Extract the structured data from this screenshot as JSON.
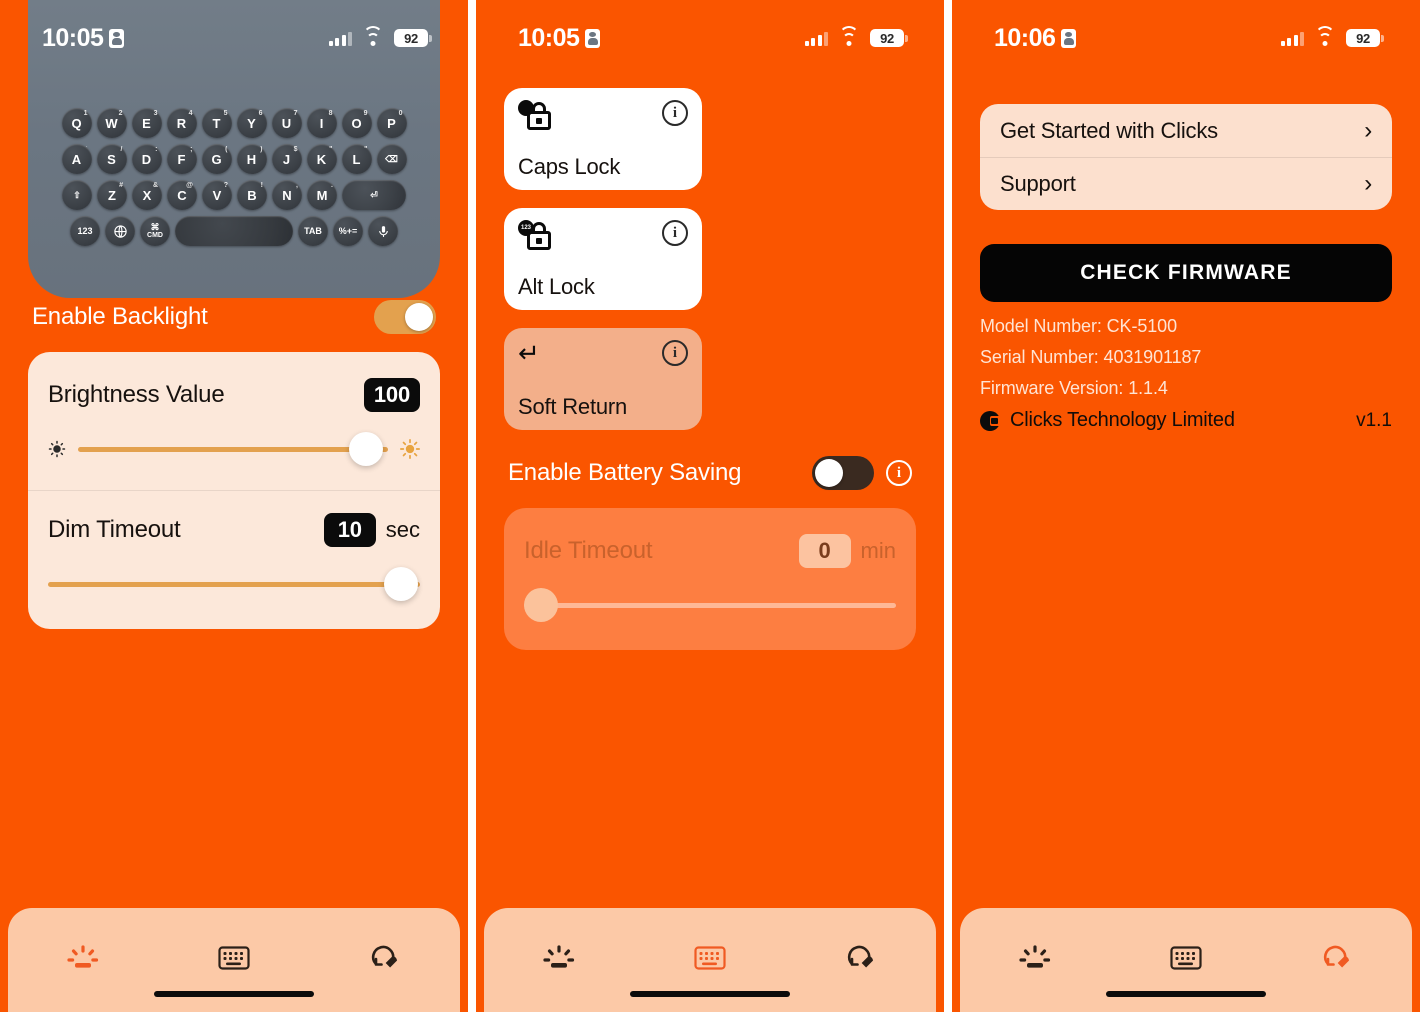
{
  "app": {
    "accent_orange": "#FA5500",
    "cream": "#FCE8DA",
    "amber": "#E3A14E",
    "tabbar_bg": "#FCC9A7"
  },
  "screens": [
    {
      "id": "backlight",
      "status": {
        "time": "10:05",
        "battery": "92",
        "id_icon": "id-card-icon",
        "signal_icon": "cellular-bars-icon",
        "wifi_icon": "wifi-icon"
      },
      "keyboard_hero": {
        "alt": "clicks-keyboard-photo",
        "row1": [
          {
            "key": "Q",
            "sup": "1"
          },
          {
            "key": "W",
            "sup": "2"
          },
          {
            "key": "E",
            "sup": "3"
          },
          {
            "key": "R",
            "sup": "4"
          },
          {
            "key": "T",
            "sup": "5"
          },
          {
            "key": "Y",
            "sup": "6"
          },
          {
            "key": "U",
            "sup": "7"
          },
          {
            "key": "I",
            "sup": "8"
          },
          {
            "key": "O",
            "sup": "9"
          },
          {
            "key": "P",
            "sup": "0"
          }
        ],
        "row2": [
          {
            "key": "A",
            "sup": "`"
          },
          {
            "key": "S",
            "sup": "/"
          },
          {
            "key": "D",
            "sup": ":"
          },
          {
            "key": "F",
            "sup": ";"
          },
          {
            "key": "G",
            "sup": "("
          },
          {
            "key": "H",
            "sup": ")"
          },
          {
            "key": "J",
            "sup": "$"
          },
          {
            "key": "K",
            "sup": "\""
          },
          {
            "key": "L",
            "sup": "\""
          },
          {
            "key": "⌫",
            "sup": ""
          }
        ],
        "row3": [
          {
            "key": "⇧",
            "sup": ""
          },
          {
            "key": "Z",
            "sup": "#"
          },
          {
            "key": "X",
            "sup": "&"
          },
          {
            "key": "C",
            "sup": "@"
          },
          {
            "key": "V",
            "sup": "?"
          },
          {
            "key": "B",
            "sup": "!"
          },
          {
            "key": "N",
            "sup": ","
          },
          {
            "key": "M",
            "sup": "."
          },
          {
            "key": "⏎",
            "sup": ""
          }
        ],
        "row4": [
          {
            "key": "123"
          },
          {
            "key": "globe"
          },
          {
            "key": "⌘",
            "sub": "CMD"
          },
          {
            "key": "space"
          },
          {
            "key": "TAB"
          },
          {
            "key": "%+="
          },
          {
            "key": "mic"
          }
        ]
      },
      "enable_toggle": {
        "label": "Enable Backlight",
        "state": "on"
      },
      "sections": [
        {
          "title": "Brightness Value",
          "value": "100",
          "unit": "",
          "slider": {
            "percent": 93,
            "left_icon": "sun-dim-icon",
            "right_icon": "sun-bright-icon"
          }
        },
        {
          "title": "Dim Timeout",
          "value": "10",
          "unit": "sec",
          "slider": {
            "percent": 95,
            "left_icon": "",
            "right_icon": ""
          }
        }
      ],
      "tabs": [
        {
          "name": "backlight",
          "icon": "backlight-icon",
          "active": true
        },
        {
          "name": "keyboard",
          "icon": "keyboard-icon",
          "active": false
        },
        {
          "name": "support",
          "icon": "support-refresh-icon",
          "active": false
        }
      ]
    },
    {
      "id": "keyboard",
      "status": {
        "time": "10:05",
        "battery": "92",
        "id_icon": "id-card-icon",
        "signal_icon": "cellular-bars-icon",
        "wifi_icon": "wifi-icon"
      },
      "tiles": [
        {
          "label": "Caps Lock",
          "icon": "caps-lock-icon",
          "badge": "",
          "badge_style": "dot",
          "active": false,
          "info": "i"
        },
        {
          "label": "Alt Lock",
          "icon": "alt-lock-icon",
          "badge": "123",
          "badge_style": "text",
          "active": false,
          "info": "i"
        },
        {
          "label": "Soft Return",
          "icon": "soft-return-icon",
          "badge": "",
          "badge_style": "none",
          "active": true,
          "info": "i"
        }
      ],
      "enable_toggle": {
        "label": "Enable Battery Saving",
        "state": "off",
        "info": "i"
      },
      "sections": [
        {
          "title": "Idle Timeout",
          "value": "0",
          "unit": "min",
          "disabled": true,
          "slider": {
            "percent": 0
          }
        }
      ],
      "tabs": [
        {
          "name": "backlight",
          "icon": "backlight-icon",
          "active": false
        },
        {
          "name": "keyboard",
          "icon": "keyboard-icon",
          "active": true
        },
        {
          "name": "support",
          "icon": "support-refresh-icon",
          "active": false
        }
      ]
    },
    {
      "id": "support",
      "status": {
        "time": "10:06",
        "battery": "92",
        "id_icon": "id-card-icon",
        "signal_icon": "cellular-bars-icon",
        "wifi_icon": "wifi-icon"
      },
      "links": [
        {
          "label": "Get Started with Clicks",
          "chevron": "›"
        },
        {
          "label": "Support",
          "chevron": "›"
        }
      ],
      "cta": {
        "label": "CHECK FIRMWARE"
      },
      "device_info": [
        "Model Number: CK-5100",
        "Serial Number: 4031901187",
        "Firmware Version: 1.1.4"
      ],
      "brand": {
        "logo": "clicks-logo-icon",
        "name": "Clicks Technology Limited",
        "version": "v1.1"
      },
      "tabs": [
        {
          "name": "backlight",
          "icon": "backlight-icon",
          "active": false
        },
        {
          "name": "keyboard",
          "icon": "keyboard-icon",
          "active": false
        },
        {
          "name": "support",
          "icon": "support-refresh-icon",
          "active": true
        }
      ]
    }
  ]
}
